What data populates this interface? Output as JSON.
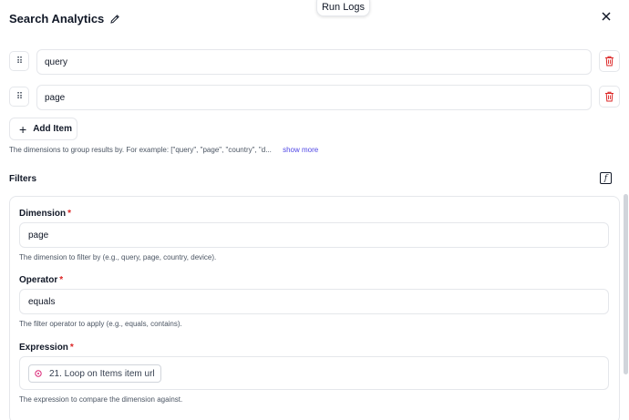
{
  "run_logs_label": "Run Logs",
  "header": {
    "title": "Search Analytics"
  },
  "dimensions": {
    "items": [
      {
        "value": "query"
      },
      {
        "value": "page"
      }
    ],
    "add_item_label": "Add Item",
    "help_text": "The dimensions to group results by. For example: [\"query\", \"page\", \"country\", \"d...",
    "show_more_label": "show more"
  },
  "filters": {
    "label": "Filters",
    "dimension": {
      "label": "Dimension",
      "required_mark": "*",
      "value": "page",
      "help": "The dimension to filter by (e.g., query, page, country, device)."
    },
    "operator": {
      "label": "Operator",
      "required_mark": "*",
      "value": "equals",
      "help": "The filter operator to apply (e.g., equals, contains)."
    },
    "expression": {
      "label": "Expression",
      "required_mark": "*",
      "chip_text": "21. Loop on Items item url",
      "help": "The expression to compare the dimension against."
    }
  },
  "colors": {
    "accent": "#4f46e5",
    "danger": "#dc2626",
    "border": "#e5e7eb"
  },
  "icons": [
    "pencil-icon",
    "close-icon",
    "drag-handle-icon",
    "trash-icon",
    "plus-icon",
    "function-icon",
    "loop-icon"
  ]
}
